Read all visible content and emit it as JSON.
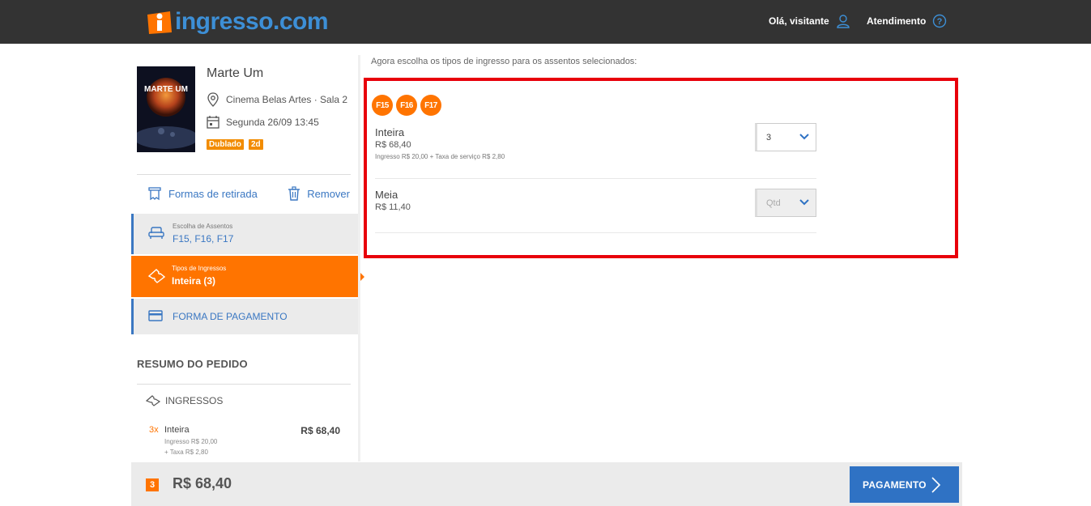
{
  "header": {
    "logo_text": "ingresso.com",
    "greeting": "Olá, visitante",
    "support": "Atendimento"
  },
  "movie": {
    "title": "Marte Um",
    "poster_text": "MARTE UM",
    "cinema": "Cinema Belas Artes · Sala 2",
    "date": "Segunda 26/09 13:45",
    "badges": [
      "Dublado",
      "2d"
    ]
  },
  "actions": {
    "pickup": "Formas de retirada",
    "remove": "Remover"
  },
  "steps": [
    {
      "label": "Escolha de Assentos",
      "value": "F15, F16, F17"
    },
    {
      "label": "Tipos de Ingressos",
      "value": "Inteira (3)"
    },
    {
      "label": "",
      "value": "FORMA DE PAGAMENTO"
    }
  ],
  "summary": {
    "title": "RESUMO DO PEDIDO",
    "section": "INGRESSOS",
    "item": {
      "qty": "3x",
      "name": "Inteira",
      "price": "R$ 68,40",
      "detail1": "Ingresso R$ 20,00",
      "detail2": "+ Taxa R$ 2,80"
    }
  },
  "main": {
    "instruction": "Agora escolha os tipos de ingresso para os assentos selecionados:",
    "seats": [
      "F15",
      "F16",
      "F17"
    ],
    "ticket_types": [
      {
        "name": "Inteira",
        "price": "R$ 68,40",
        "detail": "Ingresso R$ 20,00 + Taxa de serviço R$ 2,80",
        "selected": "3"
      },
      {
        "name": "Meia",
        "price": "R$ 11,40",
        "detail": "",
        "selected": "Qtd"
      }
    ]
  },
  "footer": {
    "count": "3",
    "total": "R$ 68,40",
    "pay_button": "PAGAMENTO"
  },
  "colors": {
    "orange": "#ff7400",
    "blue": "#2f72c4",
    "highlight_red": "#e8000b",
    "topbar": "#333333"
  }
}
